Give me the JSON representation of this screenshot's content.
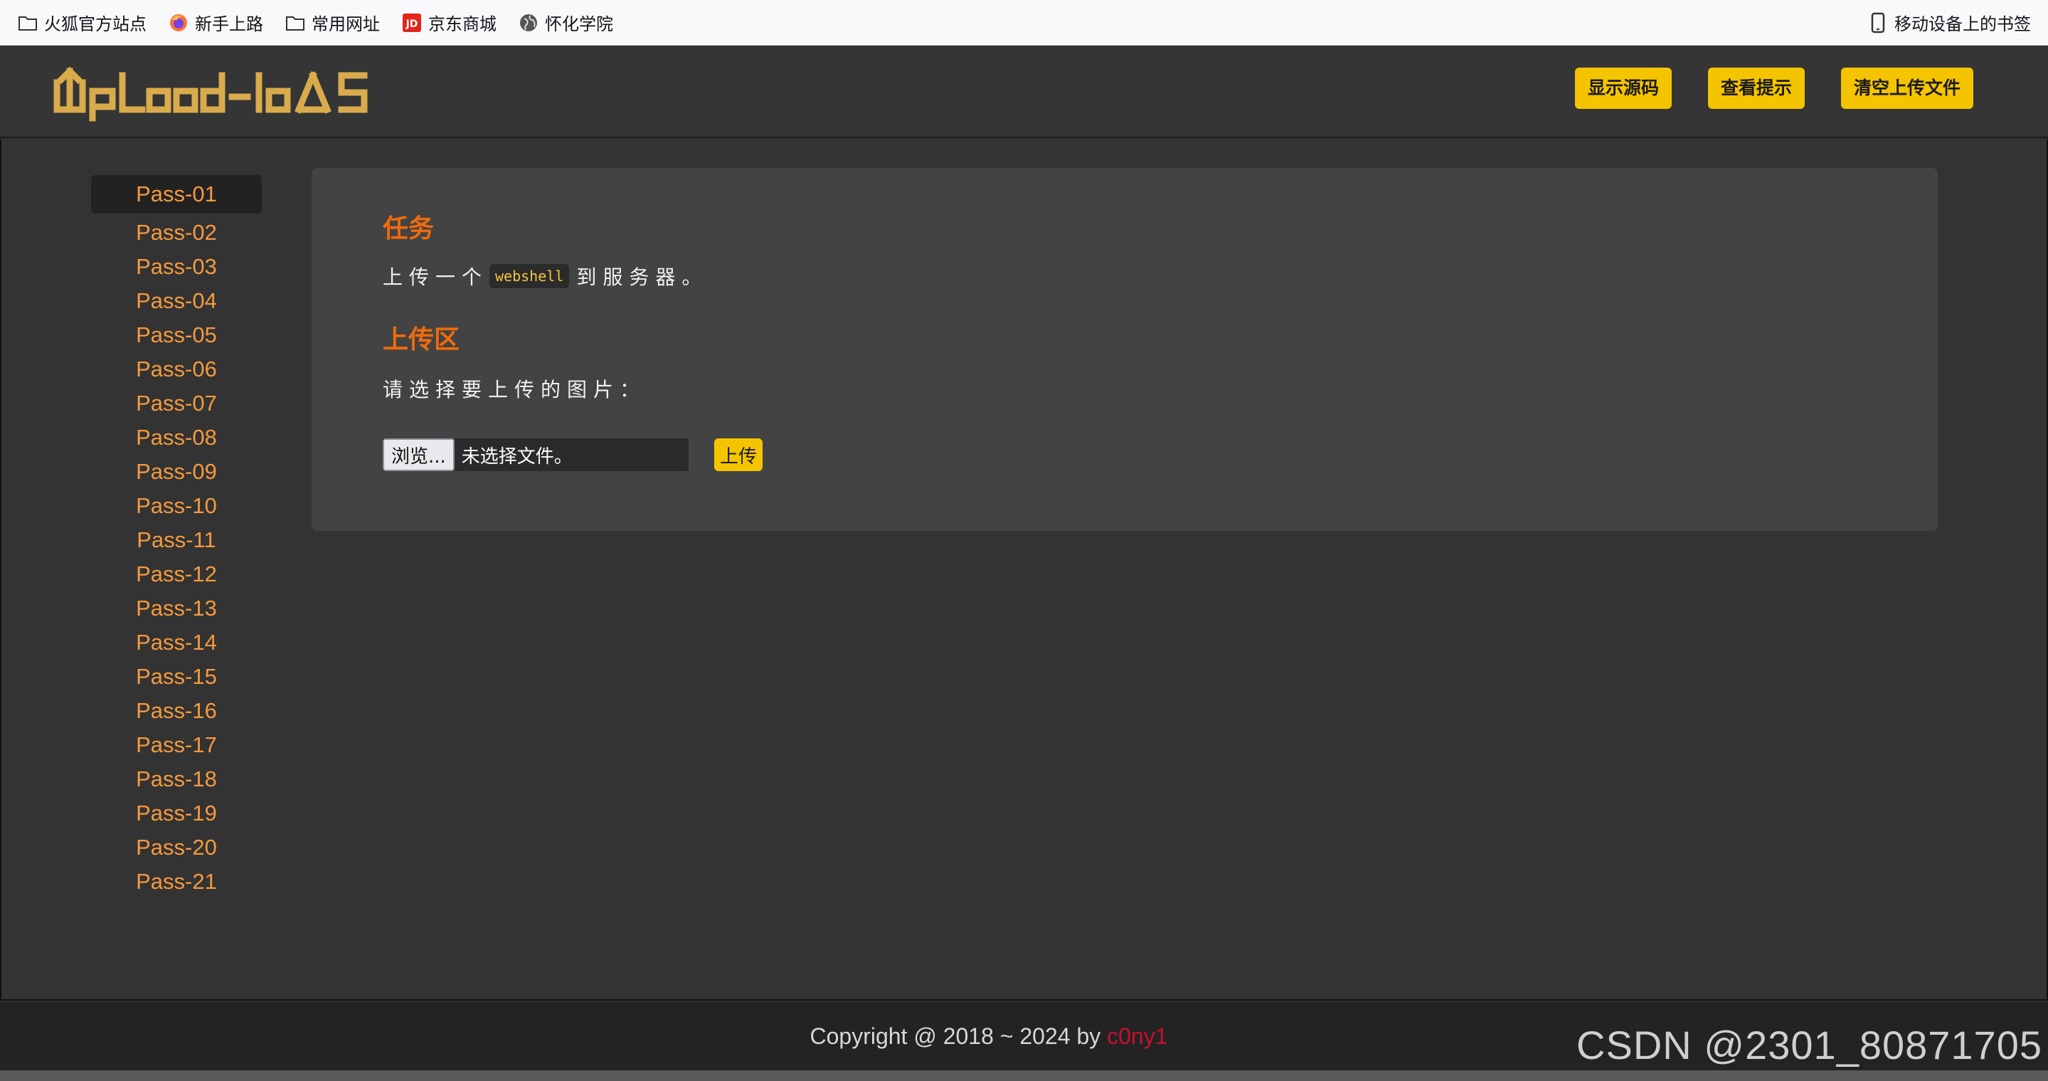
{
  "bookmarks": {
    "items": [
      {
        "label": "火狐官方站点",
        "icon": "folder-icon"
      },
      {
        "label": "新手上路",
        "icon": "firefox-icon"
      },
      {
        "label": "常用网址",
        "icon": "folder-icon"
      },
      {
        "label": "京东商城",
        "icon": "jd-icon"
      },
      {
        "label": "怀化学院",
        "icon": "globe-icon"
      }
    ],
    "mobile": {
      "label": "移动设备上的书签",
      "icon": "mobile-icon"
    },
    "jd_badge": "JD"
  },
  "header": {
    "logo_text": "Upload-labs",
    "buttons": [
      "显示源码",
      "查看提示",
      "清空上传文件"
    ],
    "logo_color": "#d9ab4c",
    "button_color": "#f5c400"
  },
  "sidebar": {
    "items": [
      "Pass-01",
      "Pass-02",
      "Pass-03",
      "Pass-04",
      "Pass-05",
      "Pass-06",
      "Pass-07",
      "Pass-08",
      "Pass-09",
      "Pass-10",
      "Pass-11",
      "Pass-12",
      "Pass-13",
      "Pass-14",
      "Pass-15",
      "Pass-16",
      "Pass-17",
      "Pass-18",
      "Pass-19",
      "Pass-20",
      "Pass-21"
    ],
    "active_index": 0,
    "link_color": "#f59a3e"
  },
  "panel": {
    "task_title": "任务",
    "task_prefix": "上传一个",
    "task_code": "webshell",
    "task_suffix": "到服务器。",
    "upload_title": "上传区",
    "choose_text": "请选择要上传的图片：",
    "browse_label": "浏览...",
    "no_file": "未选择文件。",
    "upload_label": "上传",
    "heading_color": "#ef6b0c"
  },
  "footer": {
    "copyright": "Copyright @ 2018 ~ 2024 by ",
    "author": "c0ny1",
    "watermark": "CSDN @2301_80871705"
  }
}
